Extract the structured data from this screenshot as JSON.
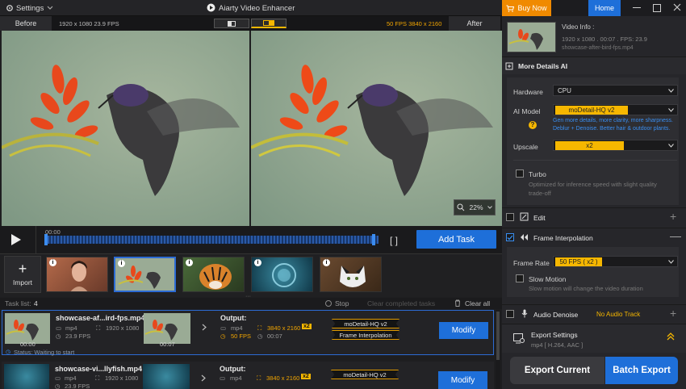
{
  "titlebar": {
    "settings": "Settings",
    "app_title": "Aiarty Video Enhancer",
    "buy_now": "Buy Now",
    "home": "Home"
  },
  "compare": {
    "before": "Before",
    "before_info": "1920 x 1080  23.9 FPS",
    "after_info": "50 FPS  3840 x 2160",
    "after": "After"
  },
  "player": {
    "time": "00:00",
    "zoom": "22%",
    "add_task": "Add Task"
  },
  "thumbs": {
    "import": "Import",
    "info": "i"
  },
  "tasklist": {
    "label": "Task list:",
    "count": "4",
    "stop": "Stop",
    "clear_completed": "Clear completed tasks",
    "clear_all": "Clear all"
  },
  "task1": {
    "name": "showcase-af...ird-fps.mp4",
    "format": "mp4",
    "resolution": "1920 x 1080",
    "fps": "23.9 FPS",
    "thumb_time_in": "00:00",
    "thumb_time_out": "00:07",
    "output_label": "Output:",
    "out_format": "mp4",
    "out_fps": "50 FPS",
    "out_res": "3840 x 2160",
    "scale": "x2",
    "duration": "00:07",
    "tag1": "moDetail-HQ  v2",
    "tag2": "Frame Interpolation",
    "modify": "Modify",
    "status": "Status: Waiting to start"
  },
  "task2": {
    "name": "showcase-vi...llyfish.mp4",
    "format": "mp4",
    "resolution": "1920 x 1080",
    "fps": "23.9 FPS",
    "output_label": "Output:",
    "out_format": "mp4",
    "out_res": "3840 x 2160",
    "scale": "x2",
    "tag1": "moDetail-HQ  v2",
    "modify": "Modify"
  },
  "video_info": {
    "title": "Video Info :",
    "line1": "1920 x 1080 . 00:07 . FPS: 23.9",
    "filename": "showcase-after-bird-fps.mp4"
  },
  "more_details": {
    "title": "More Details AI",
    "hardware_label": "Hardware",
    "hardware": "CPU",
    "model_label": "AI Model",
    "model": "moDetail-HQ  v2",
    "model_desc": "Gen more details, more clarity, more sharpness. Deblur + Denoise. Better hair & outdoor plants.",
    "upscale_label": "Upscale",
    "upscale": "x2",
    "turbo_label": "Turbo",
    "turbo_desc": "Optimized for inference speed with slight quality trade-off"
  },
  "edit": {
    "label": "Edit"
  },
  "frame_interp": {
    "label": "Frame Interpolation",
    "rate_label": "Frame Rate",
    "rate": "50 FPS  ( x2 )",
    "slow_label": "Slow Motion",
    "slow_desc": "Slow motion will change the video duration"
  },
  "audio": {
    "label": "Audio Denoise",
    "status": "No Audio Track"
  },
  "export": {
    "label": "Export Settings",
    "format": "mp4 [ H.264, AAC ]",
    "export_current": "Export Current",
    "batch_export": "Batch Export"
  },
  "colors": {
    "accent_blue": "#1e6fd9",
    "accent_orange": "#f6b700",
    "buy_orange": "#f08a00"
  }
}
